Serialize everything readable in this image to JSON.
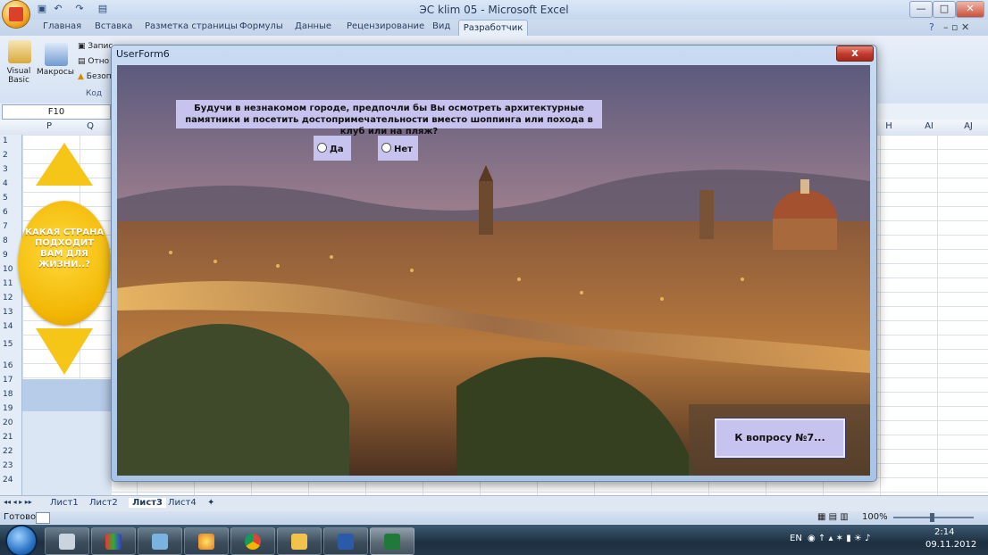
{
  "app": {
    "window_title": "ЭС klim 05 - Microsoft Excel",
    "window_controls": [
      "—",
      "□",
      "✕"
    ]
  },
  "ribbon": {
    "tabs": [
      "Главная",
      "Вставка",
      "Разметка страницы",
      "Формулы",
      "Данные",
      "Рецензирование",
      "Вид",
      "Разработчик"
    ],
    "active_tab": "Разработчик",
    "code_group": {
      "visual_basic_label": "Visual Basic",
      "macros_label": "Макросы",
      "record_label": "Запис",
      "relative_label": "Отно",
      "security_label": "Безоп",
      "group_label": "Код"
    },
    "help_icon": "?",
    "small_controls": "–  ▫  ✕"
  },
  "formula_bar": {
    "name_box": "F10"
  },
  "grid": {
    "left_columns": [
      "P",
      "Q"
    ],
    "right_columns": [
      "H",
      "AI",
      "AJ"
    ],
    "rows": [
      "1",
      "2",
      "3",
      "4",
      "5",
      "6",
      "7",
      "8",
      "9",
      "10",
      "11",
      "12",
      "13",
      "14",
      "15",
      "16",
      "17",
      "18",
      "19",
      "20",
      "21",
      "22",
      "23",
      "24"
    ]
  },
  "sheet_shape": {
    "question_text": "КАКАЯ СТРАНА ПОДХОДИТ ВАМ ДЛЯ ЖИЗНИ..?"
  },
  "sheet_tabs": {
    "tabs": [
      "Лист1",
      "Лист2",
      "Лист3",
      "Лист4"
    ],
    "active": "Лист3",
    "nav": "◂◂ ◂ ▸ ▸▸"
  },
  "status": {
    "ready": "Готово",
    "zoom": "100%"
  },
  "userform": {
    "title": "UserForm6",
    "close_label": "x",
    "question": "Будучи в незнакомом городе, предпочли бы Вы осмотреть архитектурные памятники и посетить достопримечательности вместо шоппинга или похода в клуб или на пляж?",
    "option_yes": "Да",
    "option_no": "Нет",
    "next_button": "К вопросу №7..."
  },
  "taskbar": {
    "lang": "EN",
    "time": "2:14",
    "date": "09.11.2012"
  },
  "colors": {
    "form_bg": "#c6c4ee",
    "shape_yellow": "#f5c518",
    "taskbar": "#1d2f40"
  }
}
